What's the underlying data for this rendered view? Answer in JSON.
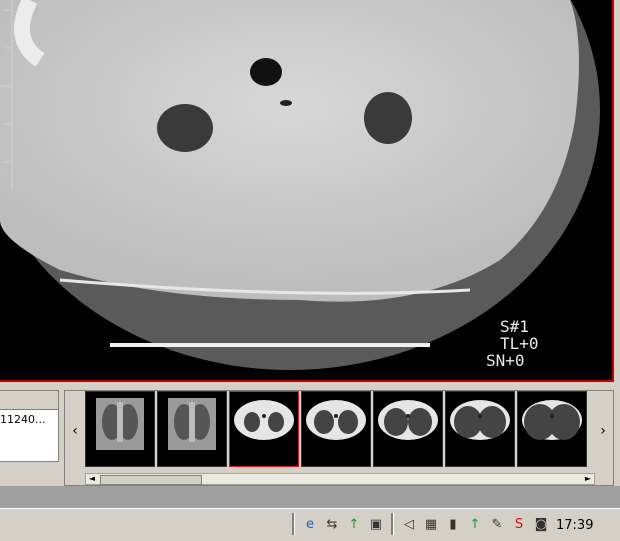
{
  "viewer": {
    "overlay": {
      "series_number": "S#1",
      "table_location": "TL+0",
      "slice_number": "SN+0"
    }
  },
  "series_panel": {
    "series_id": "11240..."
  },
  "thumbnails": [
    {
      "kind": "chest-xray",
      "selected": false
    },
    {
      "kind": "chest-xray",
      "selected": false
    },
    {
      "kind": "ct-slice",
      "selected": true
    },
    {
      "kind": "ct-slice",
      "selected": false
    },
    {
      "kind": "ct-slice",
      "selected": false
    },
    {
      "kind": "ct-slice",
      "selected": false
    },
    {
      "kind": "ct-slice",
      "selected": false
    }
  ],
  "nav": {
    "prev": "‹",
    "next": "›"
  },
  "taskbar": {
    "tray_icons": [
      "ie-icon",
      "network-icon",
      "green-arrow-icon",
      "task-icon",
      "speaker-icon",
      "display-icon",
      "battery-icon",
      "green-arrow-icon",
      "pen-icon",
      "s-icon",
      "camera-icon"
    ],
    "clock": "17:39"
  },
  "colors": {
    "selection_border": "#e02020",
    "viewer_border": "#c00000"
  }
}
